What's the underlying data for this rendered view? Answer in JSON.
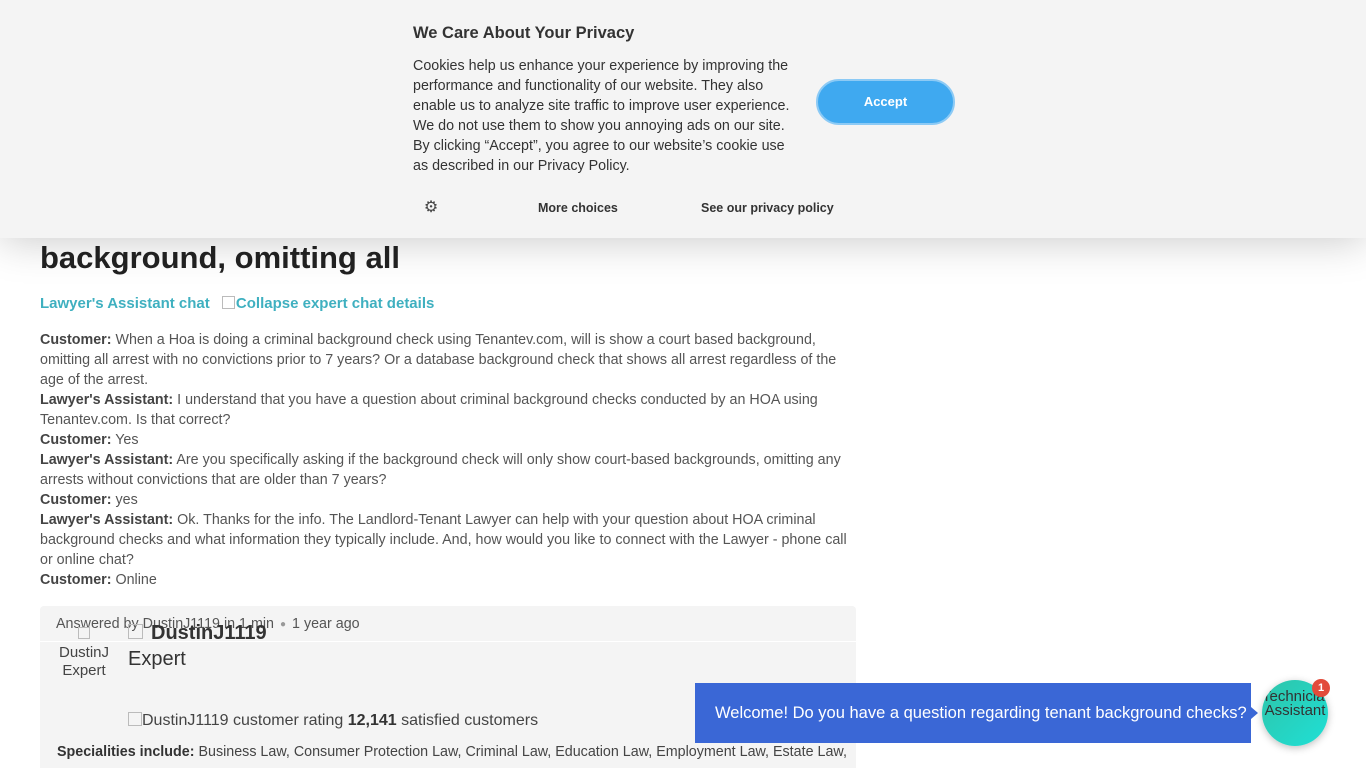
{
  "page": {
    "title_fragment": "background, omitting all",
    "chat_link": "Lawyer's Assistant chat",
    "collapse_alt": "Collapse expert chat details"
  },
  "transcript": [
    {
      "speaker": "Customer:",
      "text": " When a Hoa is doing a criminal background check using Tenantev.com, will is show a court based background, omitting all arrest with no convictions prior to 7 years? Or a database background check that shows all arrest regardless of the age of the arrest."
    },
    {
      "speaker": "Lawyer's Assistant:",
      "text": " I understand that you have a question about criminal background checks conducted by an HOA using Tenantev.com. Is that correct?"
    },
    {
      "speaker": "Customer:",
      "text": " Yes"
    },
    {
      "speaker": "Lawyer's Assistant:",
      "text": " Are you specifically asking if the background check will only show court-based backgrounds, omitting any arrests without convictions that are older than 7 years?"
    },
    {
      "speaker": "Customer:",
      "text": " yes"
    },
    {
      "speaker": "Lawyer's Assistant:",
      "text": " Ok. Thanks for the info. The Landlord-Tenant Lawyer can help with your question about HOA criminal background checks and what information they typically include. And, how would you like to connect with the Lawyer - phone call or online chat?"
    },
    {
      "speaker": "Customer:",
      "text": " Online"
    }
  ],
  "answer": {
    "answered_by": "Answered by DustinJ1119 in 1 min",
    "ago": "1 year ago",
    "avatar_alt": "DustinJ Expert",
    "expert_name": "DustinJ1119",
    "expert_title": "Expert",
    "rating_alt": "DustinJ1119 customer rating",
    "satisfied_count": "12,141",
    "satisfied_label": "satisfied customers",
    "specialities_label": "Specialities include:",
    "specialities": "Business Law, Consumer Protection Law, Criminal Law, Education Law, Employment Law, Estate Law,"
  },
  "cookie": {
    "title": "We Care About Your Privacy",
    "text": "Cookies help us enhance your experience by improving the performance and functionality of our website. They also enable us to analyze site traffic to improve user experience. We do not use them to show you annoying ads on our site. By clicking “Accept”, you agree to our website’s cookie use as described in our Privacy Policy.",
    "accept": "Accept",
    "more_choices": "More choices",
    "privacy_link": "See our privacy policy",
    "settings_icon": "gear-icon"
  },
  "chat_widget": {
    "welcome": "Welcome! Do you have a question regarding tenant background checks?",
    "launcher_alt": "Technician Assistant",
    "badge": "1",
    "launcher_colors": [
      "#2ec4a9",
      "#1fe0d6"
    ],
    "bubble_color": "#3a67d6"
  },
  "colors": {
    "accent_link": "#3fb0c0",
    "accept_button": "#3fa9f0",
    "badge": "#e24b3b"
  }
}
